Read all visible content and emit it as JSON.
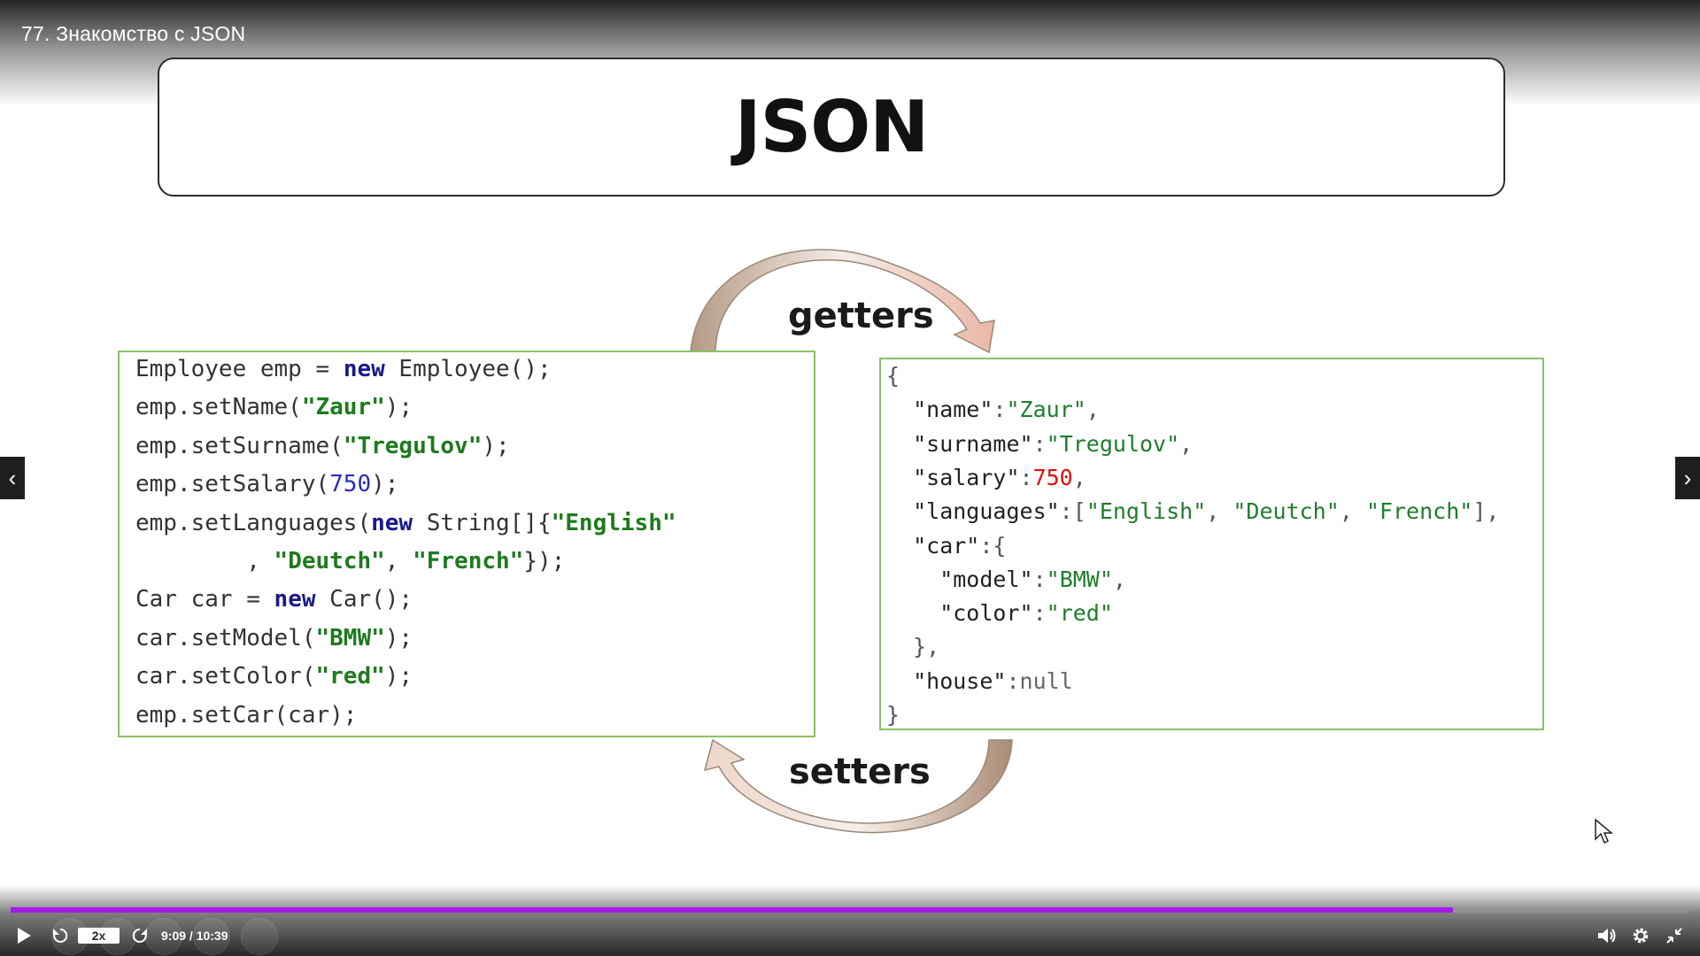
{
  "video": {
    "title": "77. Знакомство с JSON"
  },
  "slide": {
    "title": "JSON",
    "getters_label": "getters",
    "setters_label": "setters",
    "java_code": [
      [
        [
          "t",
          "Employee emp = "
        ],
        [
          "kw",
          "new"
        ],
        [
          "t",
          " Employee();"
        ]
      ],
      [
        [
          "t",
          "emp.setName("
        ],
        [
          "str",
          "\"Zaur\""
        ],
        [
          "t",
          ");"
        ]
      ],
      [
        [
          "t",
          "emp.setSurname("
        ],
        [
          "str",
          "\"Tregulov\""
        ],
        [
          "t",
          ");"
        ]
      ],
      [
        [
          "t",
          "emp.setSalary("
        ],
        [
          "num",
          "750"
        ],
        [
          "t",
          ");"
        ]
      ],
      [
        [
          "t",
          "emp.setLanguages("
        ],
        [
          "kw",
          "new"
        ],
        [
          "t",
          " String[]{"
        ],
        [
          "str",
          "\"English\""
        ]
      ],
      [
        [
          "t",
          "        , "
        ],
        [
          "str",
          "\"Deutch\""
        ],
        [
          "t",
          ", "
        ],
        [
          "str",
          "\"French\""
        ],
        [
          "t",
          "});"
        ]
      ],
      [
        [
          "t",
          "Car car = "
        ],
        [
          "kw",
          "new"
        ],
        [
          "t",
          " Car();"
        ]
      ],
      [
        [
          "t",
          "car.setModel("
        ],
        [
          "str",
          "\"BMW\""
        ],
        [
          "t",
          ");"
        ]
      ],
      [
        [
          "t",
          "car.setColor("
        ],
        [
          "str",
          "\"red\""
        ],
        [
          "t",
          ");"
        ]
      ],
      [
        [
          "t",
          "emp.setCar(car);"
        ]
      ]
    ],
    "json_code": [
      [
        [
          "jpunc",
          "{"
        ]
      ],
      [
        [
          "jkey",
          "  \"name\""
        ],
        [
          "jpunc",
          ":"
        ],
        [
          "jstr",
          "\"Zaur\""
        ],
        [
          "jpunc",
          ","
        ]
      ],
      [
        [
          "jkey",
          "  \"surname\""
        ],
        [
          "jpunc",
          ":"
        ],
        [
          "jstr",
          "\"Tregulov\""
        ],
        [
          "jpunc",
          ","
        ]
      ],
      [
        [
          "jkey",
          "  \"salary\""
        ],
        [
          "jpunc",
          ":"
        ],
        [
          "jnum",
          "750"
        ],
        [
          "jpunc",
          ","
        ]
      ],
      [
        [
          "jkey",
          "  \"languages\""
        ],
        [
          "jpunc",
          ":["
        ],
        [
          "jstr",
          "\"English\""
        ],
        [
          "jpunc",
          ", "
        ],
        [
          "jstr",
          "\"Deutch\""
        ],
        [
          "jpunc",
          ", "
        ],
        [
          "jstr",
          "\"French\""
        ],
        [
          "jpunc",
          "],"
        ]
      ],
      [
        [
          "jkey",
          "  \"car\""
        ],
        [
          "jpunc",
          ":{"
        ]
      ],
      [
        [
          "jkey",
          "    \"model\""
        ],
        [
          "jpunc",
          ":"
        ],
        [
          "jstr",
          "\"BMW\""
        ],
        [
          "jpunc",
          ","
        ]
      ],
      [
        [
          "jkey",
          "    \"color\""
        ],
        [
          "jpunc",
          ":"
        ],
        [
          "jstr",
          "\"red\""
        ]
      ],
      [
        [
          "jpunc",
          "  },"
        ]
      ],
      [
        [
          "jkey",
          "  \"house\""
        ],
        [
          "jpunc",
          ":"
        ],
        [
          "jnull",
          "null"
        ]
      ],
      [
        [
          "jpunc",
          "}"
        ]
      ]
    ]
  },
  "player": {
    "speed": "2x",
    "time": "9:09 / 10:39",
    "progress_fraction": 0.859,
    "accent_color": "#a21ae8",
    "icons": {
      "play": "play-icon",
      "rewind": "rewind-icon",
      "forward": "forward-icon",
      "volume": "volume-icon",
      "settings": "gear-icon",
      "fullscreen": "exit-fullscreen-icon"
    }
  },
  "nav": {
    "prev_icon": "chevron-left-icon",
    "next_icon": "chevron-right-icon"
  }
}
